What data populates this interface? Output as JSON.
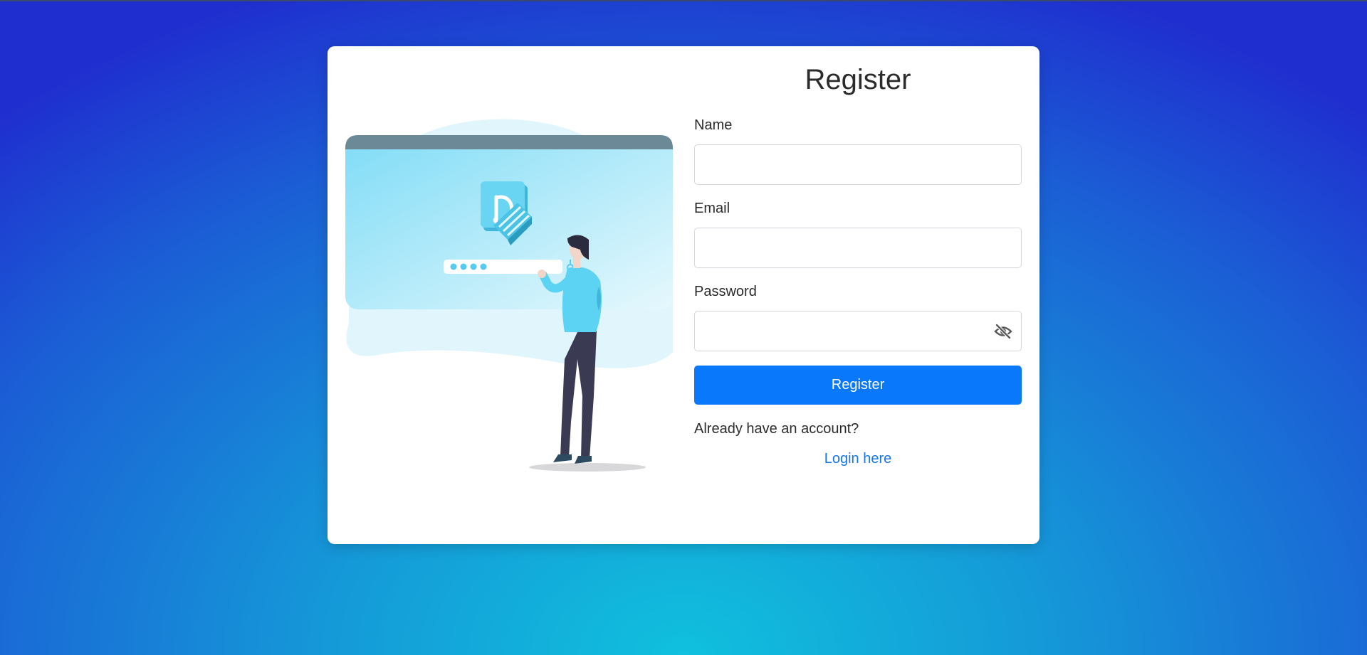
{
  "page": {
    "title": "Register"
  },
  "form": {
    "name_label": "Name",
    "name_value": "",
    "email_label": "Email",
    "email_value": "",
    "password_label": "Password",
    "password_value": "",
    "password_toggle_icon": "eye-slash-icon",
    "submit_label": "Register"
  },
  "footer": {
    "prompt": "Already have an account?",
    "login_link": "Login here"
  },
  "colors": {
    "primary": "#0a78fb",
    "link": "#1876e6",
    "illustration_accent": "#5dd3f3"
  }
}
